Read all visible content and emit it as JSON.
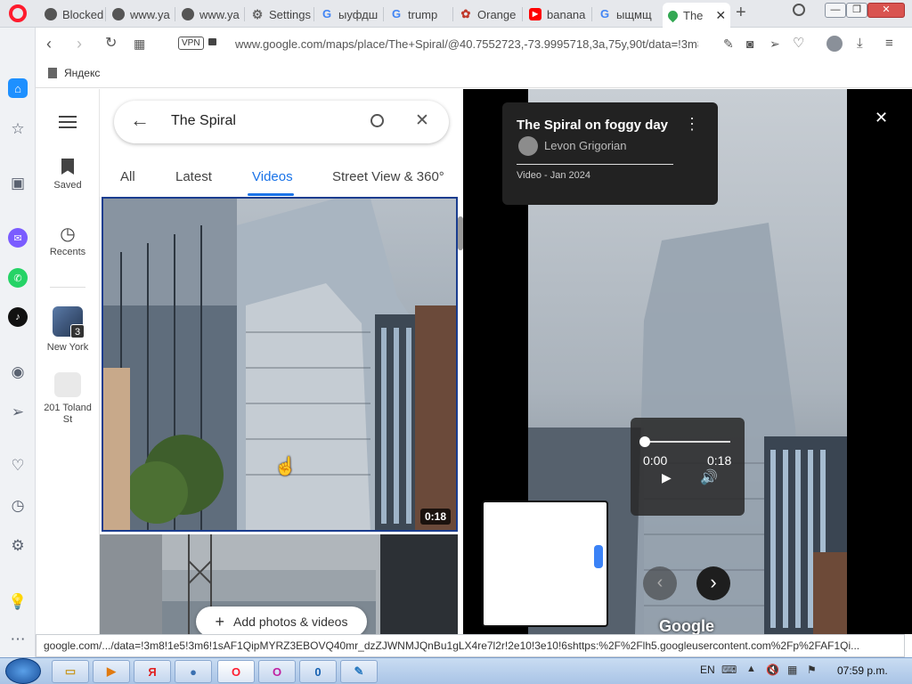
{
  "tabs": [
    {
      "label": "Blocked",
      "icon": "globe-icon"
    },
    {
      "label": "www.ya",
      "icon": "globe-icon"
    },
    {
      "label": "www.ya",
      "icon": "globe-icon"
    },
    {
      "label": "Settings",
      "icon": "gear-icon"
    },
    {
      "label": "ыуфдш",
      "icon": "google-icon"
    },
    {
      "label": "trump",
      "icon": "google-icon"
    },
    {
      "label": "Orange",
      "icon": "orange-icon"
    },
    {
      "label": "banana",
      "icon": "youtube-icon"
    },
    {
      "label": "ыщмщ",
      "icon": "google-icon"
    },
    {
      "label": "The",
      "icon": "maps-pin-icon"
    }
  ],
  "address": {
    "vpn": "VPN",
    "url": "www.google.com/maps/place/The+Spiral/@40.7552723,-73.9995718,3a,75y,90t/data=!3m8!1e"
  },
  "bookmarks": {
    "item": "Яндекс"
  },
  "rail": {
    "saved": "Saved",
    "recents": "Recents",
    "place1": "New York",
    "place1_badge": "3",
    "place2": "201 Toland St"
  },
  "search": {
    "query": "The Spiral"
  },
  "media_tabs": {
    "all": "All",
    "latest": "Latest",
    "videos": "Videos",
    "street": "Street View & 360°"
  },
  "video_tile": {
    "duration": "0:18"
  },
  "add_photos": "Add photos & videos",
  "viewer": {
    "title": "The Spiral on foggy day",
    "author": "Levon Grigorian",
    "meta": "Video - Jan 2024",
    "time_current": "0:00",
    "time_total": "0:18",
    "watermark": "Google"
  },
  "status_url": "google.com/.../data=!3m8!1e5!3m6!1sAF1QipMYRZ3EBOVQ40mr_dzZJWNMJQnBu1gLX4re7l2r!2e10!3e10!6shttps:%2F%2Flh5.googleusercontent.com%2Fp%2FAF1Qi...",
  "taskbar": {
    "lang": "EN",
    "clock": "07:59 p.m."
  },
  "colors": {
    "accent_blue": "#1a73e8",
    "opera_red": "#ff1b2d",
    "viewer_bg": "#000000"
  }
}
